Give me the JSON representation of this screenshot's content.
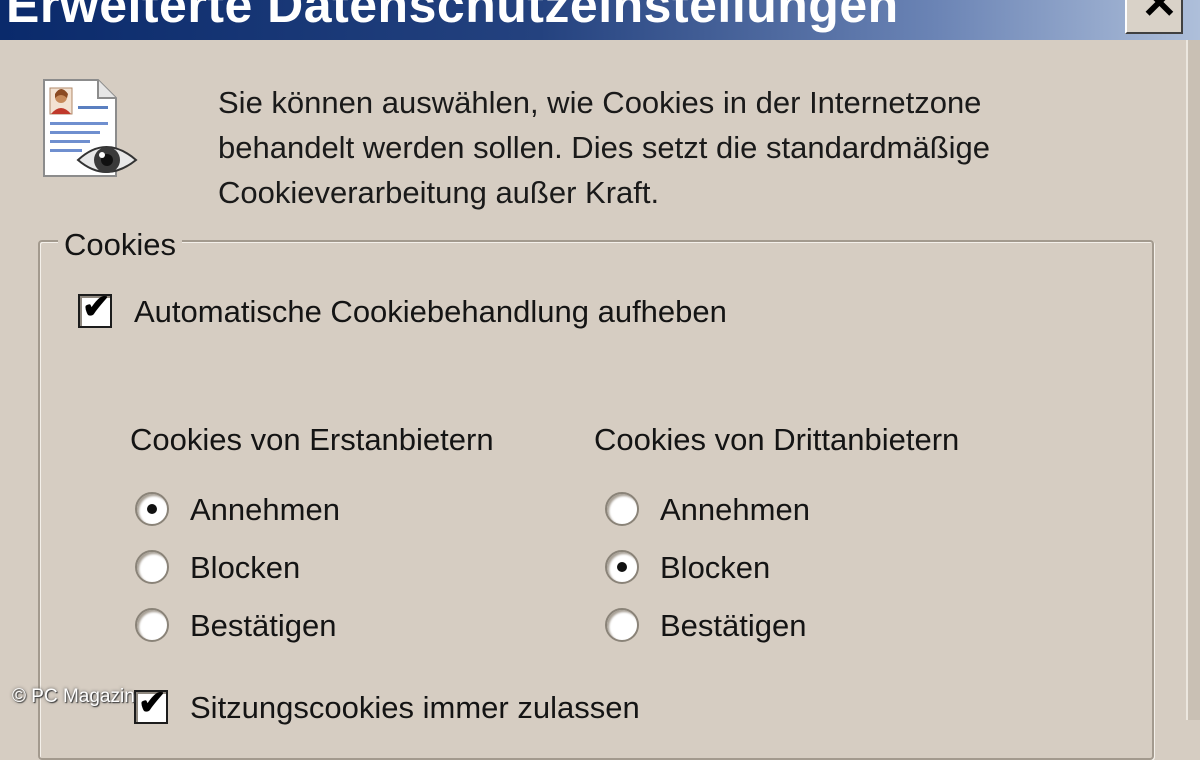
{
  "window": {
    "title": "Erweiterte Datenschutzeinstellungen",
    "close_glyph": "✕"
  },
  "intro": {
    "lines": [
      "Sie können auswählen, wie Cookies in der Internetzone",
      "behandelt werden sollen. Dies setzt die standardmäßige",
      "Cookieverarbeitung außer Kraft."
    ],
    "icon": "privacy-document-eye-icon"
  },
  "cookies_group": {
    "legend": "Cookies",
    "override_checkbox": {
      "label": "Automatische Cookiebehandlung aufheben",
      "checked": true
    },
    "first_party": {
      "heading": "Cookies von Erstanbietern",
      "options": [
        "Annehmen",
        "Blocken",
        "Bestätigen"
      ],
      "selected": "Annehmen"
    },
    "third_party": {
      "heading": "Cookies von Drittanbietern",
      "options": [
        "Annehmen",
        "Blocken",
        "Bestätigen"
      ],
      "selected": "Blocken"
    },
    "session_checkbox": {
      "label": "Sitzungscookies immer zulassen",
      "checked": true
    }
  },
  "watermark": "© PC Magazin",
  "colors": {
    "dialog_bg": "#d6cdc2",
    "titlebar_dark": "#0a2a6b",
    "titlebar_light": "#aebfda"
  }
}
